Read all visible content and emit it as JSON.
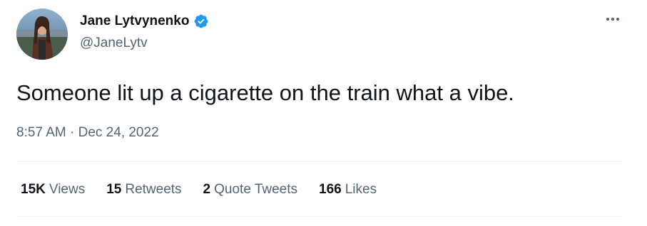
{
  "author": {
    "display_name": "Jane Lytvynenko",
    "handle": "@JaneLytv",
    "verified": true,
    "avatar_icon": "profile-photo"
  },
  "tweet": {
    "text": "Someone lit up a cigarette on the train what a vibe.",
    "time": "8:57 AM",
    "separator": "·",
    "date": "Dec 24, 2022"
  },
  "stats": {
    "views_count": "15K",
    "views_label": "Views",
    "retweets_count": "15",
    "retweets_label": "Retweets",
    "quotes_count": "2",
    "quotes_label": "Quote Tweets",
    "likes_count": "166",
    "likes_label": "Likes"
  },
  "colors": {
    "primary_text": "#0f1419",
    "secondary_text": "#536471",
    "verified_blue": "#1d9bf0",
    "divider": "#eff3f4"
  },
  "icons": {
    "verified": "verified-badge-icon",
    "more": "more-horizontal-icon"
  }
}
